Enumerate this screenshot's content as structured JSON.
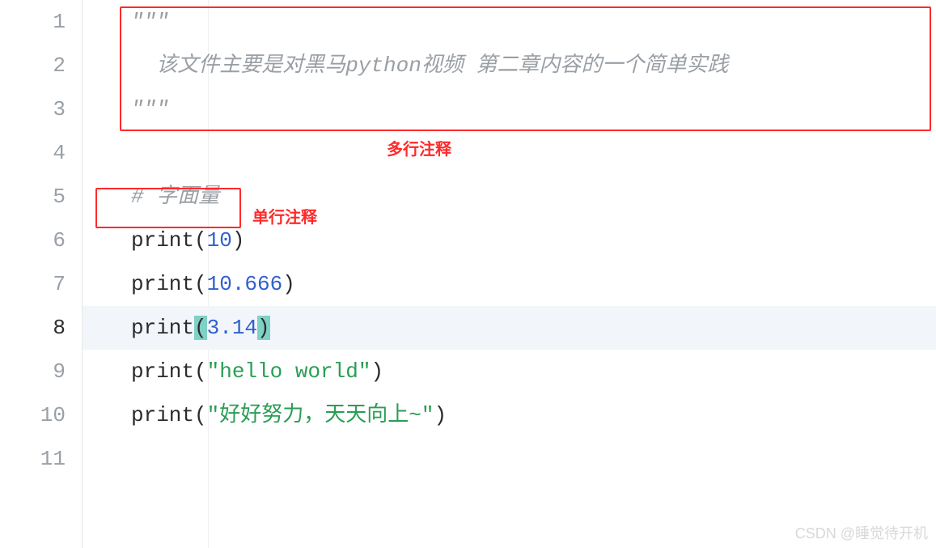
{
  "editor": {
    "current_line": 8,
    "line_numbers": [
      1,
      2,
      3,
      4,
      5,
      6,
      7,
      8,
      9,
      10,
      11
    ],
    "code": {
      "l1": "\"\"\"",
      "l2": "  该文件主要是对黑马python视频 第二章内容的一个简单实践",
      "l3": "\"\"\"",
      "l4": "",
      "l5_pre": "# ",
      "l5_txt": "字面量",
      "l6_fn": "print",
      "l6_num": "10",
      "l7_fn": "print",
      "l7_num": "10.666",
      "l8_fn": "print",
      "l8_num": "3.14",
      "l9_fn": "print",
      "l9_str": "\"hello world\"",
      "l10_fn": "print",
      "l10_str": "\"好好努力，天天向上~\""
    }
  },
  "annotations": {
    "multiline_label": "多行注释",
    "singleline_label": "单行注释"
  },
  "watermark": "CSDN @睡觉待开机"
}
